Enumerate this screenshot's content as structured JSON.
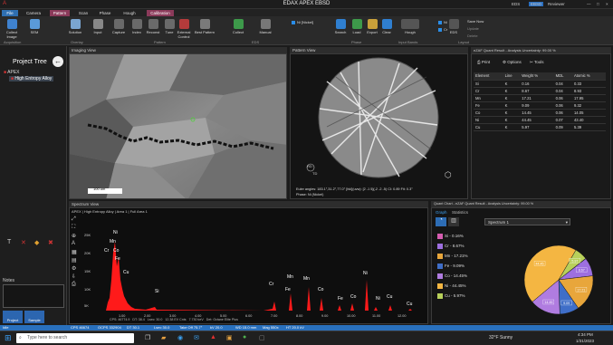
{
  "app": {
    "title": "EDAX APEX EBSD",
    "logo": "A",
    "eds_label": "EDS",
    "ebsd_label": "EBSD",
    "reviewer_label": "Reviewer",
    "user": "Matt Nowell"
  },
  "tabs": [
    {
      "label": "File"
    },
    {
      "label": "Camera"
    },
    {
      "label": "Pattern"
    },
    {
      "label": "Scan"
    },
    {
      "label": "Phase"
    },
    {
      "label": "Hough"
    },
    {
      "label": "Calibration"
    }
  ],
  "ribbon": {
    "buttons": [
      {
        "label": "Collect Image",
        "icon": "camera-icon"
      },
      {
        "label": "SEM",
        "icon": "microscope-icon"
      },
      {
        "label": "Indexing",
        "icon": "grid-icon"
      },
      {
        "label": "Solution",
        "icon": "solution-icon"
      },
      {
        "label": "Input",
        "icon": "input-icon"
      },
      {
        "label": "Capture",
        "icon": "capture-icon"
      },
      {
        "label": "Index",
        "icon": "index-icon"
      },
      {
        "label": "Reconst",
        "icon": "reconst-icon"
      },
      {
        "label": "Tune",
        "icon": "tune-icon"
      },
      {
        "label": "External Control",
        "icon": "external-icon"
      },
      {
        "label": "Best Pattern",
        "icon": "best-pattern-icon"
      },
      {
        "label": "Collect",
        "icon": "collect-icon"
      },
      {
        "label": "Manual",
        "icon": "manual-icon"
      },
      {
        "label": "Search",
        "icon": "search-icon"
      },
      {
        "label": "Load",
        "icon": "load-icon"
      },
      {
        "label": "Export",
        "icon": "export-icon"
      },
      {
        "label": "Clear",
        "icon": "clear-icon"
      },
      {
        "label": "Hough",
        "icon": "hough-icon"
      },
      {
        "label": "EDS",
        "icon": "eds-icon"
      }
    ],
    "groups": [
      "Acquisition",
      "Overlay",
      "Pattern",
      "EDS",
      "Phase",
      "Input Bands",
      "Layout"
    ],
    "checkboxes": [
      {
        "label": "Ni [Nickel]",
        "checked": true
      },
      {
        "label": "Ni",
        "checked": true
      },
      {
        "label": "Cr",
        "checked": true
      }
    ],
    "right_actions": [
      "Save Now",
      "Update",
      "Delete"
    ]
  },
  "project_tree": {
    "title": "Project Tree",
    "root": "APEX",
    "child": "High Entropy Alloy",
    "notes_label": "Notes",
    "bottom_tabs": [
      "Project",
      "Sample"
    ]
  },
  "imaging_view": {
    "title": "Imaging View",
    "scale_bar": "100 um"
  },
  "pattern_view": {
    "title": "Pattern View",
    "euler": "Euler angles: 183.1°,31.2°,77.0°",
    "plane": "[hkl](uvw): [2 -1 5](-2 -2 -5)",
    "ci": "CI: 0.89",
    "fit": "Fit: 0.3°",
    "bands": "Bands: 11",
    "phase": "Phase: Ni (Nickel)",
    "rd": "RD",
    "td": "TD"
  },
  "quant_table": {
    "title": "eZAF Quant Result - Analysis Uncertainty: 99.00 %",
    "toolbar": [
      "Print",
      "Options",
      "Tools"
    ],
    "headers": [
      "Element",
      "Line",
      "Weight %",
      "MDL",
      "Atomic %"
    ],
    "rows": [
      [
        "Si",
        "K",
        "0.16",
        "0.04",
        "0.33"
      ],
      [
        "Cr",
        "K",
        "8.67",
        "0.04",
        "8.93"
      ],
      [
        "Mn",
        "K",
        "17.21",
        "0.06",
        "17.95"
      ],
      [
        "Fe",
        "K",
        "9.09",
        "0.06",
        "9.32"
      ],
      [
        "Co",
        "K",
        "14.45",
        "0.06",
        "14.05"
      ],
      [
        "Ni",
        "K",
        "44.45",
        "0.07",
        "43.40"
      ],
      [
        "Cu",
        "K",
        "5.97",
        "0.09",
        "5.39"
      ]
    ]
  },
  "spectrum_view": {
    "title": "Spectrum View",
    "path": "APEX | High Entropy Alloy | Area 1 | Full Area 1",
    "y_ticks": [
      "25K",
      "20K",
      "15K",
      "10K",
      "5K"
    ],
    "x_ticks": [
      "1.00",
      "2.00",
      "3.00",
      "4.00",
      "5.00",
      "6.00",
      "7.00",
      "8.00",
      "9.00",
      "10.00",
      "11.00",
      "12.00"
    ],
    "peaks": [
      "Ni",
      "Mn",
      "Cr",
      "Co",
      "Fe",
      "Cu",
      "Si",
      "Cr",
      "Mn",
      "Fe",
      "Mn",
      "Co",
      "Fe",
      "Ni",
      "Co",
      "Ni",
      "Cu",
      "Cu"
    ],
    "info": [
      "CPS: 46774.9",
      "DT: 38.4",
      "Lsec: 30.0",
      "12.38 EV Cnts",
      "7.730 keV",
      "Det: Octane Elite Plus"
    ]
  },
  "quant_chart": {
    "title": "Quant Chart - eZAF Quant Result - Analysis Uncertainty: 99.00 %",
    "tabs": [
      "Graph",
      "Statistics"
    ],
    "spectrum": "Spectrum 1"
  },
  "chart_data": {
    "type": "pie",
    "categories": [
      "Si - 0.16%",
      "Cr - 8.67%",
      "Mn - 17.21%",
      "Fe - 9.09%",
      "Co - 14.45%",
      "Ni - 44.45%",
      "Cu - 5.97%"
    ],
    "values": [
      0.16,
      8.67,
      17.21,
      9.09,
      14.45,
      44.45,
      5.97
    ],
    "slice_labels": [
      "0.16",
      "8.67",
      "17.21",
      "9.09",
      "14.45",
      "44.45",
      "5.97"
    ],
    "colors": [
      "#d65db1",
      "#9d6fe0",
      "#e8a63b",
      "#3f6ec8",
      "#b07ce0",
      "#f4b642",
      "#b8d05a"
    ],
    "legend_placement": "left"
  },
  "status": {
    "state": "Idle",
    "cps": "CPS 46674",
    "ocps": "OCPS 332904",
    "dt": "DT 30.1",
    "lsec": "Lsec 30.0",
    "takeoff": "Take Off 75.7°",
    "kv": "kV 20.0",
    "wd": "WD 15.0 mm",
    "mag": "Mag 550x",
    "ht": "HT 20.0 kV"
  },
  "taskbar": {
    "search": "Type here to search",
    "weather": "32°F Sunny",
    "time": "4:34 PM",
    "date": "1/31/2023"
  }
}
